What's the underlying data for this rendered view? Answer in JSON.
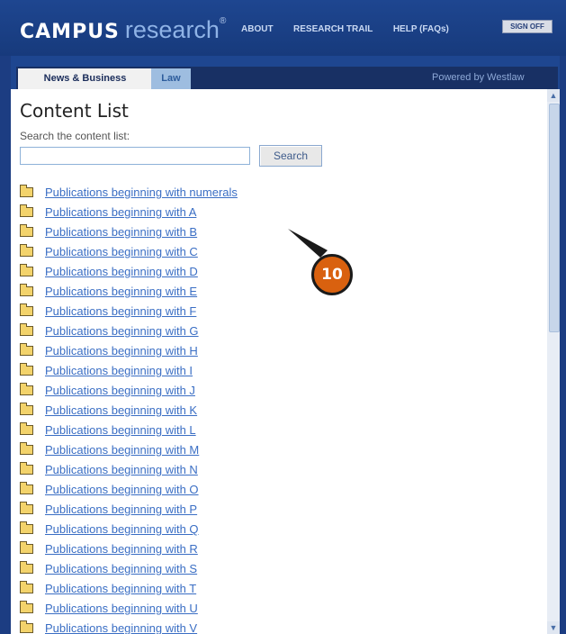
{
  "header": {
    "logo_brand": "CAMPUS",
    "logo_suffix": "research",
    "logo_mark": "®",
    "nav": [
      "ABOUT",
      "RESEARCH TRAIL",
      "HELP (FAQs)"
    ],
    "signoff_label": "SIGN OFF"
  },
  "tabs": {
    "active": "News & Business",
    "inactive": "Law",
    "powered_by": "Powered by Westlaw"
  },
  "content": {
    "title": "Content List",
    "search_label": "Search the content list:",
    "search_value": "",
    "search_button": "Search"
  },
  "list": [
    "Publications beginning with numerals",
    "Publications beginning with A",
    "Publications beginning with B",
    "Publications beginning with C",
    "Publications beginning with D",
    "Publications beginning with E",
    "Publications beginning with F",
    "Publications beginning with G",
    "Publications beginning with H",
    "Publications beginning with I",
    "Publications beginning with J",
    "Publications beginning with K",
    "Publications beginning with L",
    "Publications beginning with M",
    "Publications beginning with N",
    "Publications beginning with O",
    "Publications beginning with P",
    "Publications beginning with Q",
    "Publications beginning with R",
    "Publications beginning with S",
    "Publications beginning with T",
    "Publications beginning with U",
    "Publications beginning with V"
  ],
  "callout": {
    "number": "10"
  },
  "icons": {
    "folder": "folder-icon",
    "scroll_up": "scroll-up-icon",
    "scroll_down": "scroll-down-icon"
  }
}
